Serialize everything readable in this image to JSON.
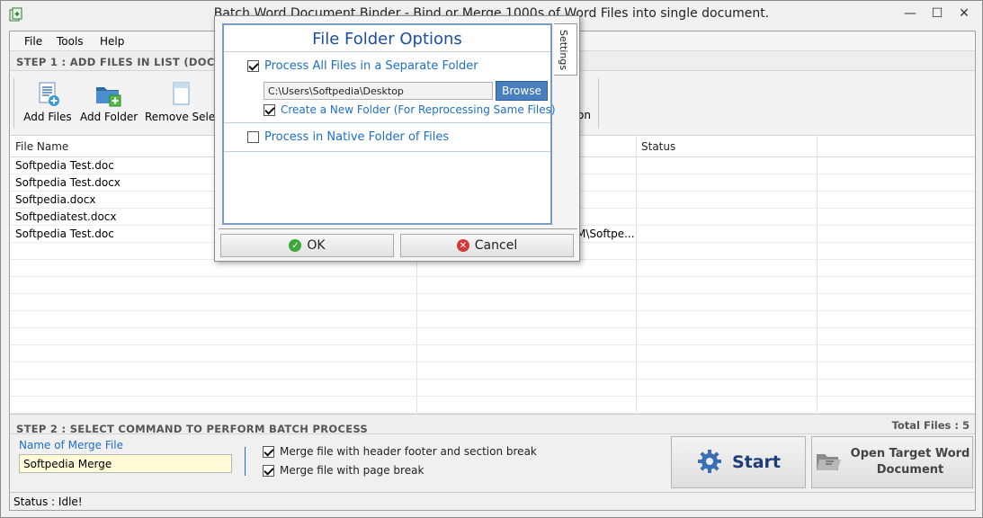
{
  "window": {
    "title": "Batch Word Document Binder - Bind or Merge 1000s of Word Files into single document.",
    "minimize": "—",
    "maximize": "☐",
    "close": "✕"
  },
  "menu": [
    "File",
    "Tools",
    "Help"
  ],
  "step1": {
    "label": "STEP 1 : ADD FILES IN LIST (DOC,"
  },
  "toolbar": {
    "add_files": "Add Files",
    "add_folder": "Add Folder",
    "remove_selected": "Remove Select",
    "hidden_partial": "on"
  },
  "table": {
    "columns": [
      "File Name",
      "Status"
    ],
    "rows": [
      {
        "file": "Softpedia Test.doc",
        "path_tail": ""
      },
      {
        "file": "Softpedia Test.docx",
        "path_tail": ""
      },
      {
        "file": "Softpedia.docx",
        "path_tail": ""
      },
      {
        "file": "Softpediatest.docx",
        "path_tail": ""
      },
      {
        "file": "Softpedia Test.doc",
        "path_tail": "M\\Softpe..."
      }
    ]
  },
  "step2": {
    "label": "STEP 2 : SELECT COMMAND TO PERFORM BATCH PROCESS",
    "total_files": "Total Files : 5",
    "merge_label": "Name of Merge File",
    "merge_value": "Softpedia Merge",
    "opt1": "Merge file with header footer and section break",
    "opt1_checked": true,
    "opt2": "Merge file with page break",
    "opt2_checked": true,
    "start": "Start",
    "open_target_line1": "Open Target Word",
    "open_target_line2": "Document"
  },
  "status": {
    "text": "Status  :  Idle!"
  },
  "dialog": {
    "title": "File Folder Options",
    "settings_tab": "Settings",
    "opt_separate": "Process All Files in a Separate Folder",
    "opt_separate_checked": true,
    "path": "C:\\Users\\Softpedia\\Desktop",
    "browse": "Browse",
    "opt_new_folder": "Create a New Folder (For Reprocessing Same Files)",
    "opt_new_folder_checked": true,
    "opt_native": "Process in Native Folder of Files",
    "opt_native_checked": false,
    "ok": "OK",
    "cancel": "Cancel"
  },
  "colors": {
    "accent": "#1f6fc5",
    "dialog_title": "#1a4fa0",
    "merge_bg": "#fffbd6",
    "browse_bg": "#4a7fbf"
  }
}
